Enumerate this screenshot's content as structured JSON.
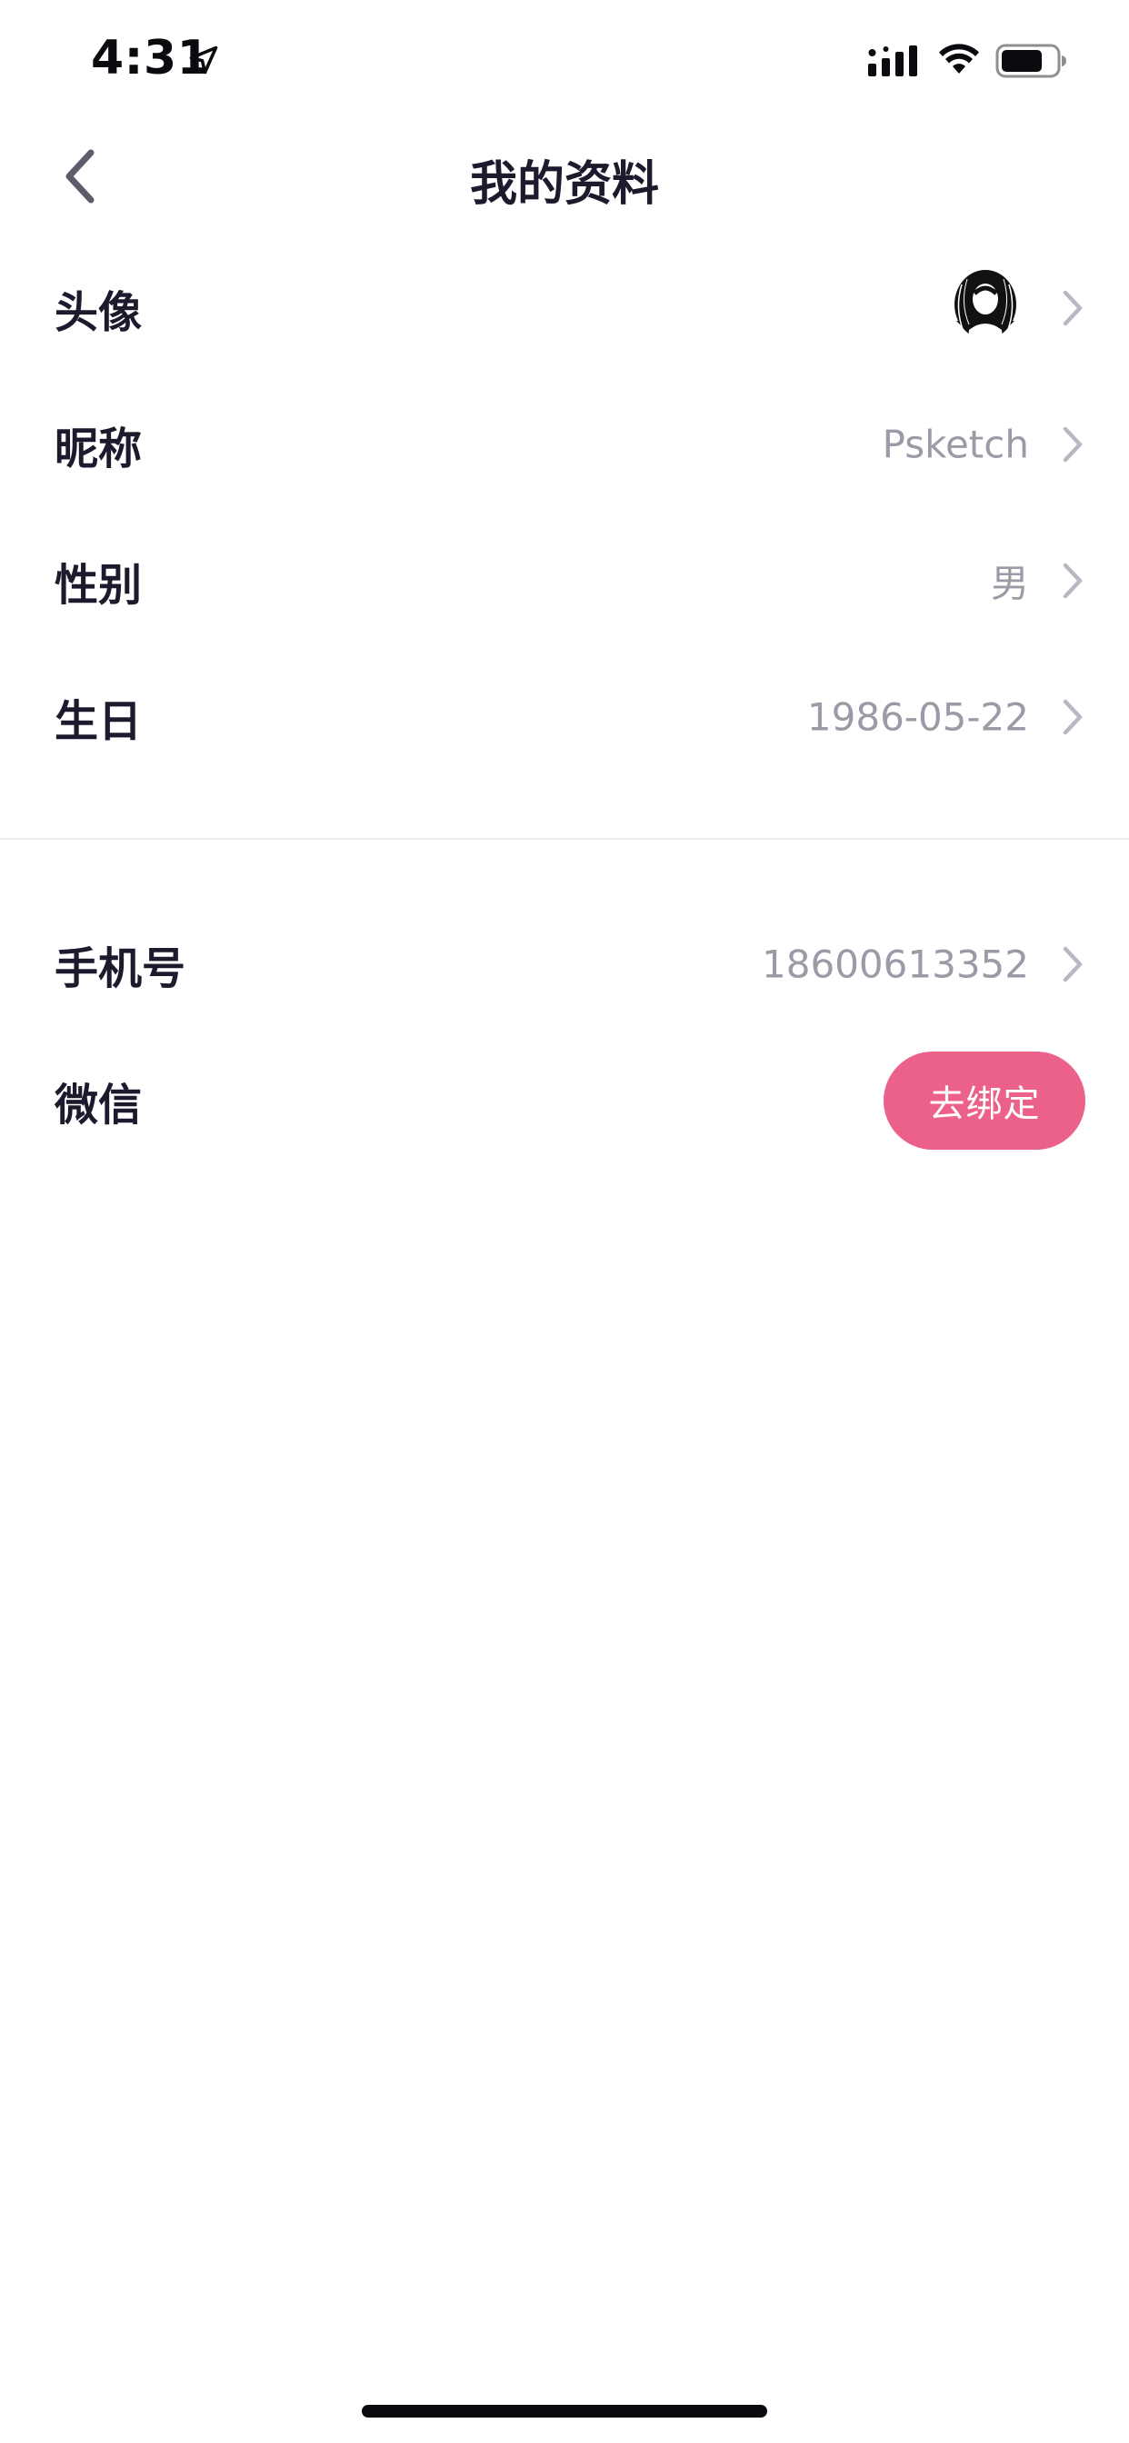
{
  "status_bar": {
    "time": "4:31"
  },
  "nav": {
    "title": "我的资料"
  },
  "profile_rows": [
    {
      "label": "头像",
      "value": ""
    },
    {
      "label": "昵称",
      "value": "Psketch"
    },
    {
      "label": "性别",
      "value": "男"
    },
    {
      "label": "生日",
      "value": "1986-05-22"
    }
  ],
  "account_rows": [
    {
      "label": "手机号",
      "value": "18600613352"
    },
    {
      "label": "微信",
      "button_label": "去绑定"
    }
  ],
  "colors": {
    "accent": "#ec6189",
    "label_text": "#1c1a2c",
    "value_text": "#9b9aa6",
    "chevron": "#b9b8c2",
    "divider": "#ececf0"
  },
  "icons": {
    "back": "chevron-left-icon",
    "row_arrow": "chevron-right-icon",
    "location": "location-arrow-icon",
    "signal": "cellular-signal-icon",
    "wifi": "wifi-icon",
    "battery": "battery-icon"
  }
}
